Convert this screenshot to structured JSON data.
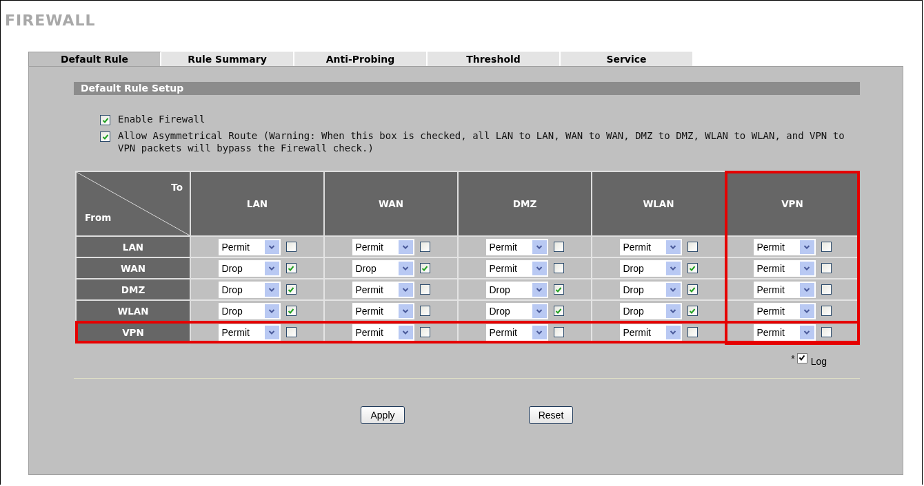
{
  "title": "FIREWALL",
  "tabs": [
    {
      "label": "Default Rule",
      "selected": true
    },
    {
      "label": "Rule Summary",
      "selected": false
    },
    {
      "label": "Anti-Probing",
      "selected": false
    },
    {
      "label": "Threshold",
      "selected": false
    },
    {
      "label": "Service",
      "selected": false
    }
  ],
  "section_title": "Default Rule Setup",
  "options": [
    {
      "label": "Enable Firewall",
      "checked": true
    },
    {
      "label": "Allow Asymmetrical Route (Warning: When this box is checked, all LAN to LAN, WAN to WAN, DMZ to DMZ, WLAN to WLAN, and VPN to VPN packets will bypass the Firewall check.)",
      "checked": true
    }
  ],
  "matrix": {
    "corner_to": "To",
    "corner_from": "From",
    "columns": [
      {
        "label": "LAN",
        "highlighted": false
      },
      {
        "label": "WAN",
        "highlighted": false
      },
      {
        "label": "DMZ",
        "highlighted": false
      },
      {
        "label": "WLAN",
        "highlighted": false
      },
      {
        "label": "VPN",
        "highlighted": true
      }
    ],
    "rows": [
      {
        "label": "LAN",
        "highlighted": false,
        "cells": [
          {
            "action": "Permit",
            "log": false
          },
          {
            "action": "Permit",
            "log": false
          },
          {
            "action": "Permit",
            "log": false
          },
          {
            "action": "Permit",
            "log": false
          },
          {
            "action": "Permit",
            "log": false
          }
        ]
      },
      {
        "label": "WAN",
        "highlighted": false,
        "cells": [
          {
            "action": "Drop",
            "log": true
          },
          {
            "action": "Drop",
            "log": true
          },
          {
            "action": "Permit",
            "log": false
          },
          {
            "action": "Drop",
            "log": true
          },
          {
            "action": "Permit",
            "log": false
          }
        ]
      },
      {
        "label": "DMZ",
        "highlighted": false,
        "cells": [
          {
            "action": "Drop",
            "log": true
          },
          {
            "action": "Permit",
            "log": false
          },
          {
            "action": "Drop",
            "log": true
          },
          {
            "action": "Drop",
            "log": true
          },
          {
            "action": "Permit",
            "log": false
          }
        ]
      },
      {
        "label": "WLAN",
        "highlighted": false,
        "cells": [
          {
            "action": "Drop",
            "log": true
          },
          {
            "action": "Permit",
            "log": false
          },
          {
            "action": "Drop",
            "log": true
          },
          {
            "action": "Drop",
            "log": true
          },
          {
            "action": "Permit",
            "log": false
          }
        ]
      },
      {
        "label": "VPN",
        "highlighted": true,
        "cells": [
          {
            "action": "Permit",
            "log": false
          },
          {
            "action": "Permit",
            "log": false
          },
          {
            "action": "Permit",
            "log": false
          },
          {
            "action": "Permit",
            "log": false
          },
          {
            "action": "Permit",
            "log": false
          }
        ]
      }
    ]
  },
  "log_legend": {
    "marker": "*",
    "label": "Log",
    "checked": true
  },
  "buttons": [
    "Apply",
    "Reset"
  ]
}
